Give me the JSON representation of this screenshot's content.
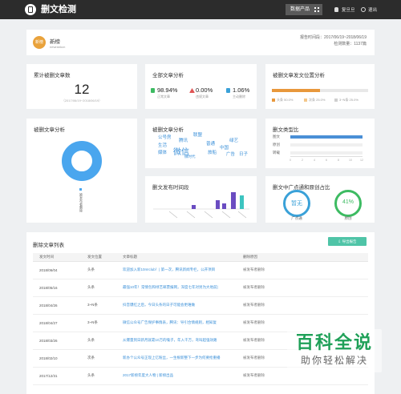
{
  "header": {
    "app_title": "删文检测",
    "product_button": "数据产品",
    "user_name": "复旦旦",
    "exit_label": "退出"
  },
  "account": {
    "avatar_text": "新榜",
    "name": "新榜",
    "sub": "newrankcn",
    "report_time": "报告时间段：2017/06/19~2018/06/19",
    "check_count": "检测数量：1137篇"
  },
  "cards": {
    "total_deleted": {
      "title": "累计被删文章数",
      "value": "12",
      "sub": "（2017/06/19~2018/06/19）"
    },
    "all_analysis": {
      "title": "全部文章分析",
      "stats": [
        {
          "value": "98.94%",
          "label": "正常文章",
          "color": "#3dbb62"
        },
        {
          "value": "0.00%",
          "label": "违规文章",
          "color": "#e05454"
        },
        {
          "value": "1.06%",
          "label": "主动删除",
          "color": "#3aa1d8"
        }
      ]
    },
    "position_analysis": {
      "title": "被删文章发文位置分析",
      "head_pct": 0.5,
      "legend": [
        {
          "label": "头条 50.0%",
          "color": "#e8983c"
        },
        {
          "label": "次条 25.0%",
          "color": "#f3c78a"
        },
        {
          "label": "3~N条 25.0%",
          "color": "#cfcfcf"
        }
      ]
    },
    "deleted_analysis": {
      "title": "被删文章分析",
      "donut_label": "被发布者删除"
    },
    "word_cloud": {
      "title": "被删文章分析",
      "words": [
        "公号房",
        "腾讯",
        "联盟",
        "绿艺",
        "生活",
        "普通",
        "中国",
        "媒体",
        "微信",
        "旅船",
        "广告",
        "日子",
        "微时代",
        "想象力"
      ]
    },
    "type_ratio": {
      "title": "删文类型比",
      "rows": [
        {
          "label": "图文",
          "value": 1.0
        },
        {
          "label": "原创",
          "value": 0.0
        },
        {
          "label": "转载",
          "value": 0.0
        }
      ],
      "ticks": [
        "0",
        "2",
        "4",
        "6",
        "8",
        "10",
        "12"
      ]
    },
    "publish_time": {
      "title": "删文发布时间段"
    },
    "ad_ratio": {
      "title": "删文中广点通和原创占比",
      "items": [
        {
          "value": "暂无",
          "label": "广点通",
          "color": "#3aa1d8"
        },
        {
          "value": "41%",
          "label": "原创",
          "color": "#3dbb62"
        }
      ]
    }
  },
  "list": {
    "title": "删除文章列表",
    "export_label": "导出报告",
    "columns": [
      "发文时间",
      "发文位置",
      "文章标题",
      "删除原因"
    ],
    "rows": [
      [
        "2018/06/04",
        "头条",
        "欢迎加入新10m!club！| 第一次，腾讯新闻专栏，公开项目",
        "被发布者删除"
      ],
      [
        "2018/05/16",
        "头条",
        "最强10年！常情包和绿艺邮票报网，深度七年对另为大地前|",
        "被发布者删除"
      ],
      [
        "2018/04/26",
        "3~N条",
        "抖音爆红之后，今日头条的日子可能会更难做",
        "被发布者删除"
      ],
      [
        "2018/04/27",
        "3~N条",
        "微信公众号广告保护事情表，腾讯：导引合情规则，相知复",
        "被发布者删除"
      ],
      [
        "2018/03/26",
        "头条",
        "从爆量到日新月就靠10万的嗓子，年入千万，弯叫超强效路",
        "被发布者删除"
      ],
      [
        "2018/02/10",
        "次条",
        "新办个公众号正现上亿粉丝，一生根新整下一步为何要抢重播",
        "被发布者删除"
      ],
      [
        "2017/12/31",
        "头条",
        "2017新榜年度大人物 | 新榜出品",
        "被发布者删除"
      ]
    ]
  },
  "watermark": {
    "title": "百科全说",
    "sub": "助你轻松解决"
  }
}
